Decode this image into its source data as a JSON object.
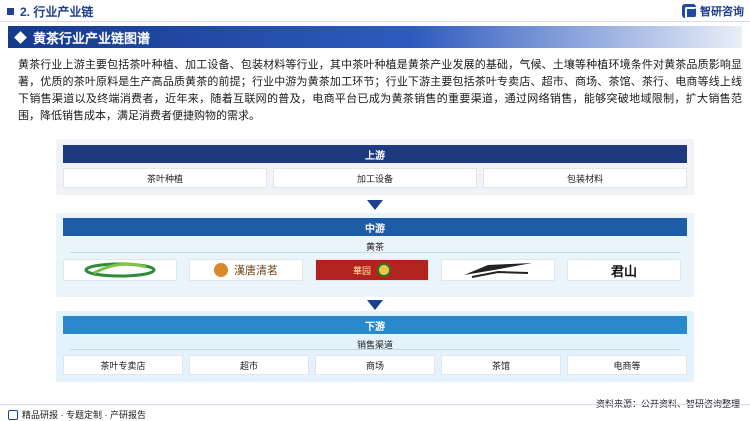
{
  "header": {
    "title": "2. 行业产业链",
    "logo_text": "智研咨询",
    "accent": "#1f3f8f"
  },
  "section": {
    "title": "黄茶行业产业链图谱",
    "paragraph": "黄茶行业上游主要包括茶叶种植、加工设备、包装材料等行业，其中茶叶种植是黄茶产业发展的基础，气候、土壤等种植环境条件对黄茶品质影响显著，优质的茶叶原料是生产高品质黄茶的前提；行业中游为黄茶加工环节；行业下游主要包括茶叶专卖店、超市、商场、茶馆、茶行、电商等线上线下销售渠道以及终端消费者，近年来，随着互联网的普及，电商平台已成为黄茶销售的重要渠道，通过网络销售，能够突破地域限制，扩大销售范围，降低销售成本，满足消费者便捷购物的需求。"
  },
  "upstream": {
    "label": "上游",
    "items": [
      "茶叶种植",
      "加工设备",
      "包装材料"
    ]
  },
  "midstream": {
    "label": "中游",
    "sub": "黄茶",
    "logos": [
      {
        "name": "green-swoosh-logo"
      },
      {
        "name": "hanshou-tea-logo",
        "text": "漢唐清茗"
      },
      {
        "name": "red-banner-tea-logo",
        "text": "華园"
      },
      {
        "name": "black-wing-logo"
      },
      {
        "name": "calligraphy-logo",
        "text": "君山"
      }
    ]
  },
  "downstream": {
    "label": "下游",
    "sub": "销售渠道",
    "items": [
      "茶叶专卖店",
      "超市",
      "商场",
      "茶馆",
      "电商等"
    ]
  },
  "footer": {
    "left": "精品研报 · 专题定制 · 产研报告",
    "source": "资料来源：公开资料、智研咨询整理"
  }
}
